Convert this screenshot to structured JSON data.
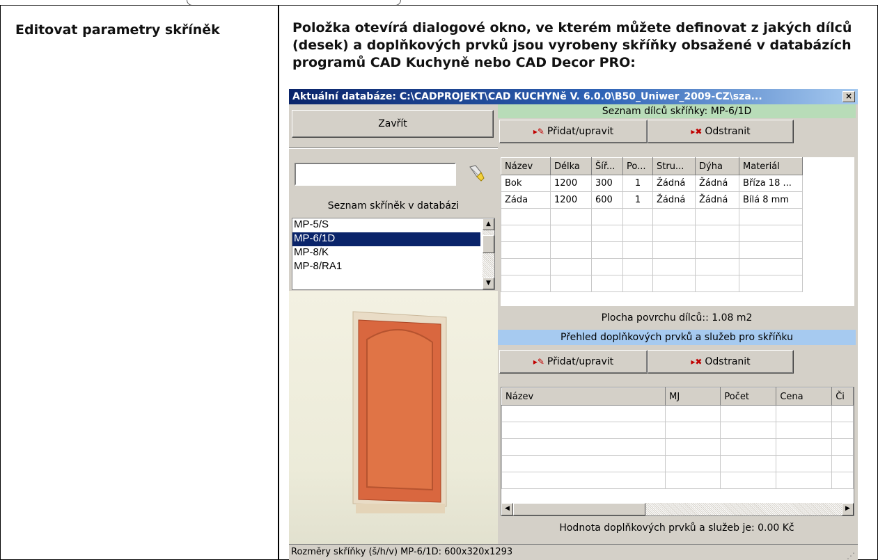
{
  "doc": {
    "term": "Editovat parametry skříněk",
    "description": "Položka otevírá dialogové okno, ve kterém můžete definovat z jakých dílců (desek) a doplňkových prvků jsou vyrobeny skříňky obsažené v databázích programů CAD Kuchyně nebo CAD Decor PRO:"
  },
  "dialog": {
    "title": "Aktuální databáze: C:\\CADPROJEKT\\CAD KUCHYNě V. 6.0.0\\B50_Uniwer_2009-CZ\\sza...",
    "close_glyph": "×",
    "close_button": "Zavřít",
    "search_value": "",
    "cabinet_list_header": "Seznam skříněk v databázi",
    "cabinets": [
      "MP-5/S",
      "MP-6/1D",
      "MP-8/K",
      "MP-8/RA1"
    ],
    "selected_cabinet": "MP-6/1D",
    "parts_header": "Seznam dílců skříňky: MP-6/1D",
    "add_edit_button": "Přidat/upravit",
    "remove_button": "Odstranit",
    "parts_columns": [
      "Název",
      "Délka",
      "Šíř...",
      "Po...",
      "Stru...",
      "Dýha",
      "Materiál"
    ],
    "parts_rows": [
      [
        "Bok",
        "1200",
        "300",
        "1",
        "Žádná",
        "Žádná",
        "Bříza 18 ..."
      ],
      [
        "Záda",
        "1200",
        "600",
        "1",
        "Žádná",
        "Žádná",
        "Bílá 8 mm"
      ]
    ],
    "surface_area": "Plocha povrchu dílců:: 1.08 m2",
    "accessories_header": "Přehled doplňkových prvků a služeb pro skříňku",
    "accessory_columns": [
      "Název",
      "MJ",
      "Počet",
      "Cena",
      "Či"
    ],
    "accessories_value": "Hodnota doplňkových prvků a služeb je: 0.00 Kč",
    "status": "Rozměry skříňky (š/h/v) MP-6/1D: 600x320x1293",
    "colors": {
      "parts_header_bg": "#b8dcb8",
      "accessories_header_bg": "#a6caf0",
      "selection": "#0a246a",
      "door": "#d9673f"
    }
  }
}
